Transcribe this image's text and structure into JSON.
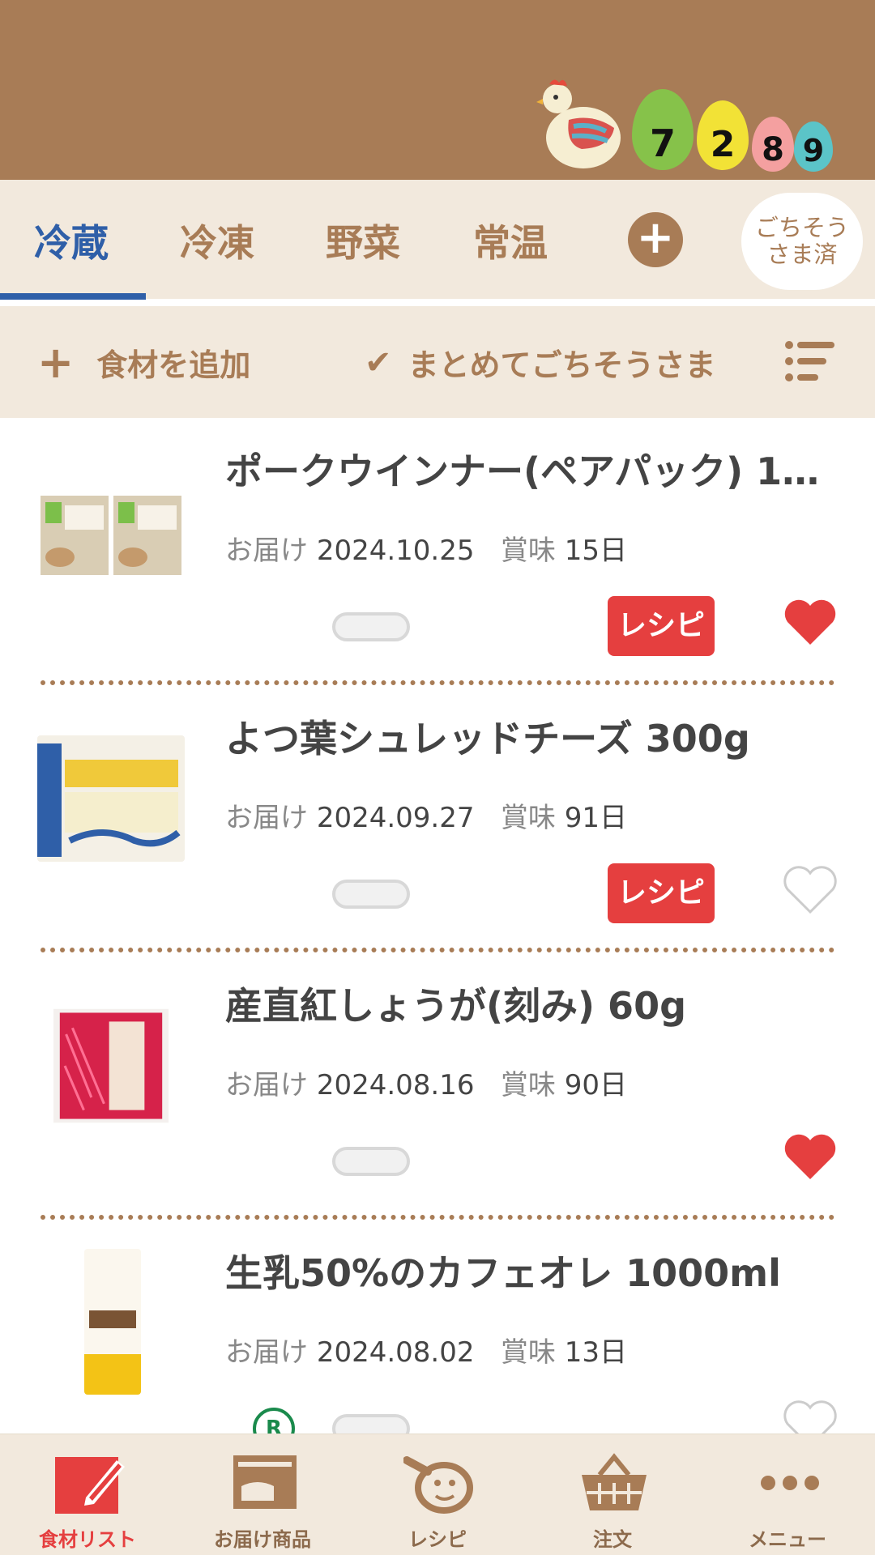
{
  "header": {
    "egg_digits": [
      "7",
      "2",
      "8",
      "9"
    ]
  },
  "tabs": [
    {
      "label": "冷蔵",
      "active": true
    },
    {
      "label": "冷凍",
      "active": false
    },
    {
      "label": "野菜",
      "active": false
    },
    {
      "label": "常温",
      "active": false
    }
  ],
  "gochiso_done": {
    "line1": "ごちそう",
    "line2": "さま済"
  },
  "actionbar": {
    "add_label": "食材を追加",
    "bulk_label": "まとめてごちそうさま"
  },
  "items": [
    {
      "name": "ポークウインナー(ペアパック) 1…",
      "delivery_label": "お届け",
      "delivery_date": "2024.10.25",
      "expiry_label": "賞味",
      "expiry": "15日",
      "recipe_label": "レシピ",
      "has_recipe": true,
      "favorite": true
    },
    {
      "name": "よつ葉シュレッドチーズ 300g",
      "delivery_label": "お届け",
      "delivery_date": "2024.09.27",
      "expiry_label": "賞味",
      "expiry": "91日",
      "recipe_label": "レシピ",
      "has_recipe": true,
      "favorite": false
    },
    {
      "name": "産直紅しょうが(刻み) 60g",
      "delivery_label": "お届け",
      "delivery_date": "2024.08.16",
      "expiry_label": "賞味",
      "expiry": "90日",
      "has_recipe": false,
      "favorite": true
    },
    {
      "name": "生乳50%のカフェオレ 1000ml",
      "delivery_label": "お届け",
      "delivery_date": "2024.08.02",
      "expiry_label": "賞味",
      "expiry": "13日",
      "has_recipe": false,
      "favorite": false
    }
  ],
  "bottom_nav": [
    {
      "label": "食材リスト",
      "icon": "pencil-note-icon",
      "active": true
    },
    {
      "label": "お届け商品",
      "icon": "delivery-box-icon",
      "active": false
    },
    {
      "label": "レシピ",
      "icon": "pot-icon",
      "active": false
    },
    {
      "label": "注文",
      "icon": "basket-icon",
      "active": false
    },
    {
      "label": "メニュー",
      "icon": "more-dots-icon",
      "active": false
    }
  ],
  "colors": {
    "header_bg": "#a87c56",
    "tab_bg": "#f2e9dd",
    "active_tab": "#2f5fa8",
    "recipe_red": "#e53f3f"
  }
}
